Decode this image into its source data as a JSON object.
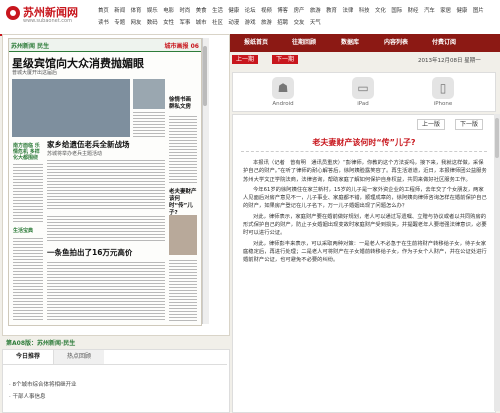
{
  "site": {
    "name": "苏州新闻网",
    "url": "www.subaonet.com"
  },
  "nav": [
    "首页",
    "新闻",
    "体育",
    "娱乐",
    "电影",
    "时尚",
    "美食",
    "生活",
    "健康",
    "论坛",
    "视频",
    "博客",
    "房产",
    "旅游",
    "教育",
    "法律",
    "科技",
    "文化",
    "国际",
    "财经",
    "汽车",
    "家居",
    "健康",
    "图片",
    "读书",
    "专题",
    "网友",
    "数码",
    "女性",
    "军事",
    "城市",
    "社区",
    "动漫",
    "游戏",
    "旅游",
    "招聘",
    "交友",
    "天气"
  ],
  "subnav": {
    "tabs": [
      "报纸首页",
      "往期回顾",
      "数据库",
      "内容列表",
      "付费订阅"
    ]
  },
  "pager": {
    "prev": "上一期",
    "next": "下一期",
    "date": "2013年12月08日 星期一",
    "prev_page": "上一版",
    "next_page": "下一版"
  },
  "newspaper": {
    "section_label": "苏州新闻 民生",
    "page_no": "城市画报 06",
    "headline_main": "星级宾馆向大众消费抛媚眼",
    "subhead": "普城大厦开出这届后",
    "headline_right": "徐情书画 群私文房",
    "headline_two": "家乡给遗伍老兵全新战场",
    "headline_two_sub": "苏城将举办老兵主题活动",
    "headline_center": "老夫妻财产该何时“传”儿子?",
    "headline_three": "一条鱼拍出了16万元高价",
    "headline_three_sub": "",
    "left_col_head": "南方面临 乐情危机 多样化大都围绕",
    "left_col_head2": "生活宝典"
  },
  "caption": "第A08版：苏州新闻·民生",
  "apps": [
    {
      "icon": "android-icon",
      "label": "Android"
    },
    {
      "icon": "ipad-icon",
      "label": "iPad"
    },
    {
      "icon": "iphone-icon",
      "label": "iPhone"
    }
  ],
  "article": {
    "title": "老夫妻财产该何时“传”儿子?",
    "paragraphs": [
      "本报讯（记者　曾有明　通讯员重庆）“彭律师，你教的这个方法妥吗，接下来，我就这样做，采保护自己的财产。”在听了律师的耐心解答后，徐阿姨脸露笑容了。再生活道道，近日，本报律师团公益服务苏州大学文正学院法商，法律咨询，帮助家庭了解如何保护自身权益，共同来做好社区服务工作。",
      "今年61岁的徐阿姨住在家兰新村，15岁的儿子是一家外资企业的工程师，去年交了个女朋友，两家人见面后对房产意见不一，儿子事业、家庭都不错，顺理成章的，徐阿姨向律师咨询怎样在婚前保护自己的财产，如果房产登记在儿子名下，万一儿子婚姻出现了问题怎么办？",
      "对此，律师表示，家庭财产要在婚前做好规划，老人可以通过写遗嘱、立赠与协议或者以共同购房的形式保护自己的财产，防止子女婚姻出现变故时家庭财产受到损失，并提醒老年人要增强法律意识，必要时可以进行公证。",
      "对此，律师彭丰来表示，可以采取两种对策：一是老人不必急于在生前将财产转移给子女，待子女家庭稳定后，再进行处理；二是老人可将财产在子女婚前转移给子女，作为子女个人财产，并在公证处进行婚前财产公证，也可避免不必要的纠纷。"
    ]
  },
  "tabs": {
    "items": [
      "今日推荐",
      "热点回顾"
    ],
    "list": [
      "8个城市综合体将相继开业",
      "干部人事信息"
    ]
  },
  "colors": {
    "brand_red": "#c8161d",
    "dark_red": "#8c1914",
    "paper_green": "#2e7c3a"
  }
}
